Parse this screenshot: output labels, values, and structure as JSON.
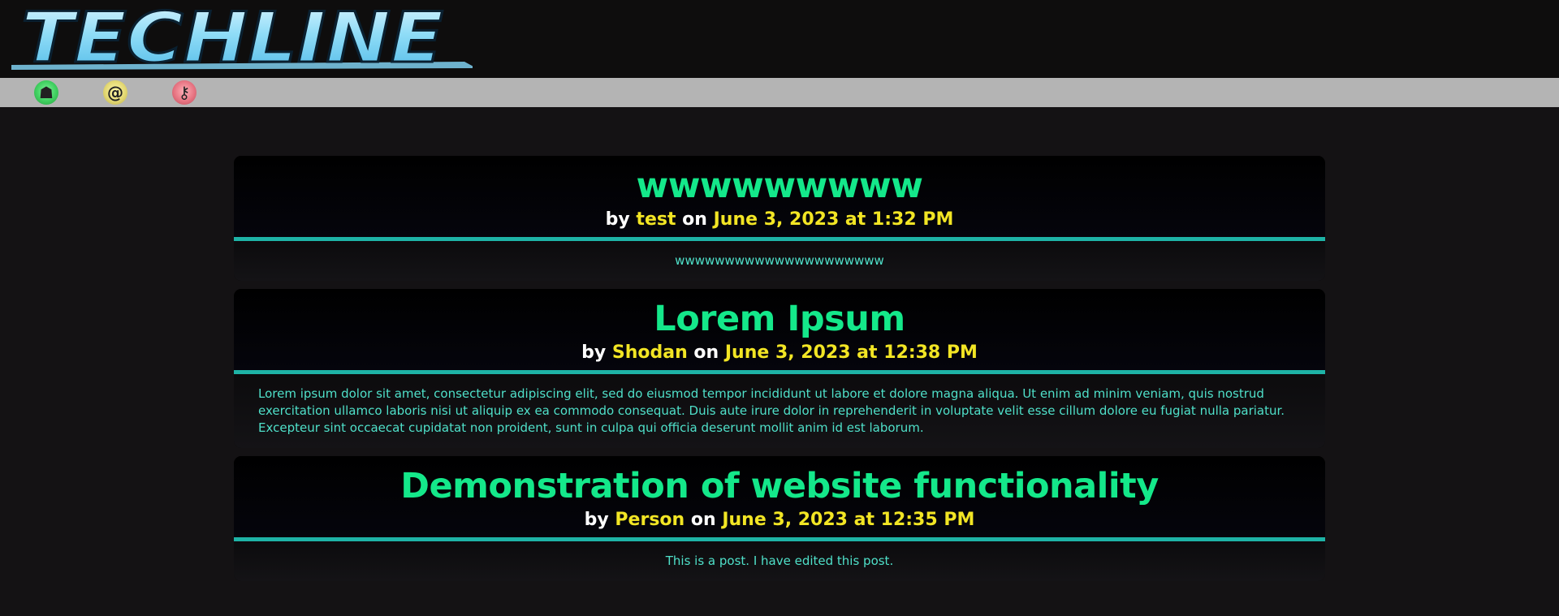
{
  "site": {
    "logo_text": "TECHLINE"
  },
  "nav": {
    "items": [
      {
        "name": "home",
        "icon": "home-icon",
        "glyph": "☗"
      },
      {
        "name": "contact",
        "icon": "at-icon",
        "glyph": "@"
      },
      {
        "name": "login",
        "icon": "key-icon",
        "glyph": "⚷"
      }
    ]
  },
  "colors": {
    "title": "#14e88a",
    "highlight": "#f2e524",
    "divider": "#1eb3a6",
    "body_text": "#4fe0c9"
  },
  "posts": [
    {
      "title": "wwwwwwwww",
      "by": "by",
      "author": "test",
      "on": "on",
      "date": "June 3, 2023 at 1:32 PM",
      "body": "wwwwwwwwwwwwwwwwwwwww"
    },
    {
      "title": "Lorem Ipsum",
      "by": "by",
      "author": "Shodan",
      "on": "on",
      "date": "June 3, 2023 at 12:38 PM",
      "body": "Lorem ipsum dolor sit amet, consectetur adipiscing elit, sed do eiusmod tempor incididunt ut labore et dolore magna aliqua. Ut enim ad minim veniam, quis nostrud exercitation ullamco laboris nisi ut aliquip ex ea commodo consequat. Duis aute irure dolor in reprehenderit in voluptate velit esse cillum dolore eu fugiat nulla pariatur. Excepteur sint occaecat cupidatat non proident, sunt in culpa qui officia deserunt mollit anim id est laborum."
    },
    {
      "title": "Demonstration of website functionality",
      "by": "by",
      "author": "Person",
      "on": "on",
      "date": "June 3, 2023 at 12:35 PM",
      "body": "This is a post. I have edited this post."
    }
  ]
}
